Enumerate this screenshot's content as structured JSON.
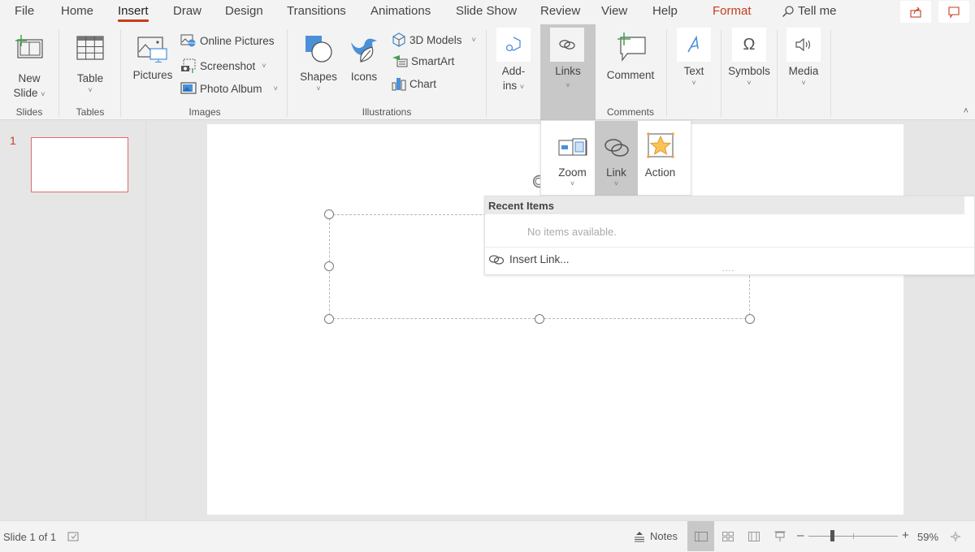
{
  "tabs": [
    {
      "label": "File",
      "active": false
    },
    {
      "label": "Home",
      "active": false
    },
    {
      "label": "Insert",
      "active": true
    },
    {
      "label": "Draw",
      "active": false
    },
    {
      "label": "Design",
      "active": false
    },
    {
      "label": "Transitions",
      "active": false
    },
    {
      "label": "Animations",
      "active": false
    },
    {
      "label": "Slide Show",
      "active": false
    },
    {
      "label": "Review",
      "active": false
    },
    {
      "label": "View",
      "active": false
    },
    {
      "label": "Help",
      "active": false
    },
    {
      "label": "Format",
      "active": false
    }
  ],
  "tell_me": {
    "label": "Tell me",
    "icon": "search-icon"
  },
  "header_buttons": {
    "share_icon": "share-icon",
    "comments_icon": "comments-icon"
  },
  "ribbon": {
    "groups": {
      "slides": "Slides",
      "tables": "Tables",
      "images": "Images",
      "illustrations": "Illustrations",
      "comments": "Comments"
    },
    "new_slide": {
      "line1": "New",
      "line2": "Slide"
    },
    "table": "Table",
    "pictures": "Pictures",
    "online_pictures": "Online Pictures",
    "screenshot": "Screenshot",
    "photo_album": "Photo Album",
    "shapes": "Shapes",
    "icons": "Icons",
    "models_3d": "3D Models",
    "smartart": "SmartArt",
    "chart": "Chart",
    "addins": {
      "line1": "Add-",
      "line2": "ins"
    },
    "links": "Links",
    "comment": "Comment",
    "text": "Text",
    "symbols": "Symbols",
    "media": "Media",
    "caret": "˅",
    "collapse": "˄"
  },
  "links_menu": {
    "zoom": "Zoom",
    "link": "Link",
    "action": "Action"
  },
  "recent_panel": {
    "header": "Recent Items",
    "empty": "No items available.",
    "insert_link": "Insert Link...",
    "grip": "...."
  },
  "thumbnails": [
    {
      "number": "1"
    }
  ],
  "status": {
    "slide_info": "Slide 1 of 1",
    "notes": "Notes",
    "zoom_level": "59%",
    "zoom_fraction": 0.59,
    "minus": "–",
    "plus": "+"
  },
  "colors": {
    "accent": "#c43e1c",
    "ribbon_bg": "#f3f3f3",
    "selected_bg": "#c8c8c8",
    "icon_blue": "#4a90d9"
  }
}
